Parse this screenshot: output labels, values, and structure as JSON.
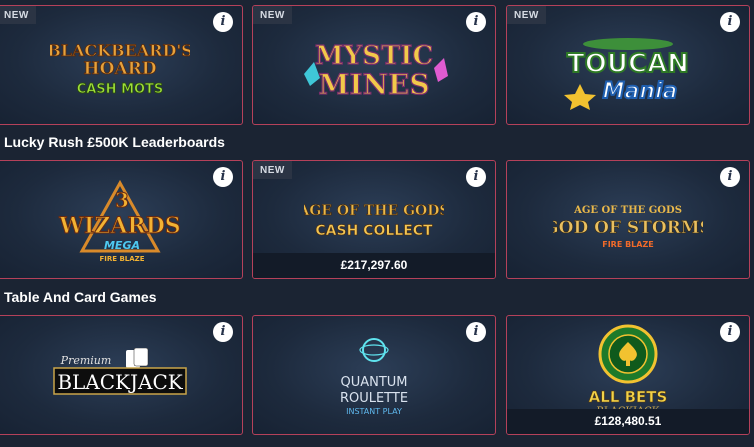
{
  "sections": [
    {
      "heading": "",
      "tiles": [
        {
          "badge": "NEW",
          "logo_text": [
            "BLACKBEARD'S",
            "HOARD",
            "CASH MOTS"
          ]
        },
        {
          "badge": "NEW",
          "logo_text": [
            "MYSTIC",
            "MINES"
          ]
        },
        {
          "badge": "NEW",
          "logo_text": [
            "TOUCAN",
            "Mania"
          ]
        }
      ]
    },
    {
      "heading": "Lucky Rush £500K Leaderboards",
      "tiles": [
        {
          "logo_text": [
            "3",
            "WIZARDS",
            "MEGA",
            "FIRE BLAZE"
          ]
        },
        {
          "badge": "NEW",
          "logo_text": [
            "AGE OF THE GODS",
            "CASH COLLECT"
          ],
          "jackpot": "£217,297.60"
        },
        {
          "logo_text": [
            "AGE OF THE GODS",
            "GOD OF STORMS",
            "FIRE BLAZE"
          ]
        }
      ]
    },
    {
      "heading": "Table And Card Games",
      "tiles": [
        {
          "logo_text": [
            "Premium",
            "BLACKJACK"
          ]
        },
        {
          "logo_text": [
            "QUANTUM",
            "ROULETTE",
            "INSTANT PLAY"
          ]
        },
        {
          "logo_text": [
            "ALL BETS",
            "BLACKJACK"
          ],
          "jackpot": "£128,480.51"
        }
      ]
    }
  ],
  "info_icon_glyph": "i",
  "colors": {
    "background": "#1b2433",
    "tile_border": "#b5415a",
    "badge_bg": "#2b3444",
    "jackpot_bar": "#131b28"
  },
  "icons": [
    "info-icon"
  ]
}
